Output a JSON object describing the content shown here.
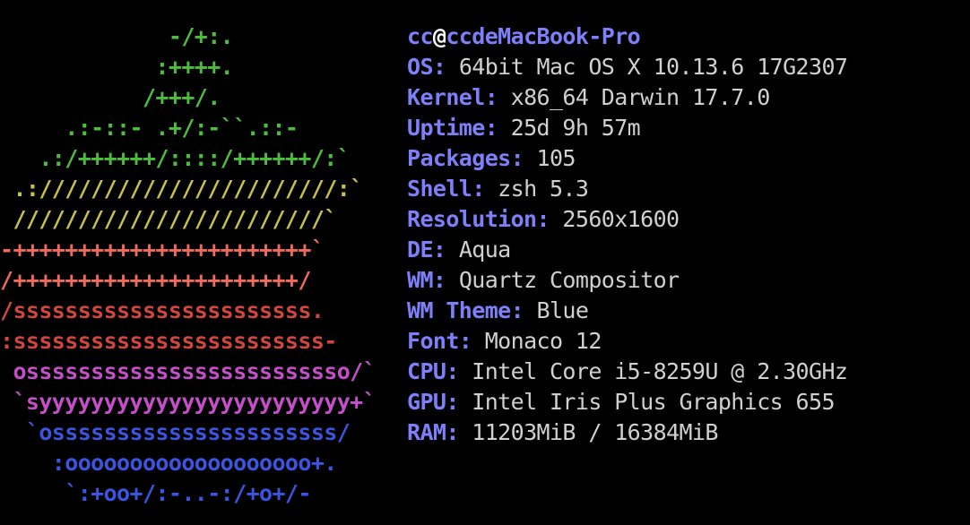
{
  "header": {
    "user": "cc",
    "at": "@",
    "host": "ccdeMacBook-Pro"
  },
  "logo": {
    "lines": [
      {
        "text": "             -/+:.",
        "color": "#4dbd3d"
      },
      {
        "text": "            :++++.",
        "color": "#4dbd3d"
      },
      {
        "text": "           /+++/.",
        "color": "#4dbd3d"
      },
      {
        "text": "     .:-::- .+/:-``.::-",
        "color": "#4dbd3d"
      },
      {
        "text": "   .:/++++++/::::/++++++/:`",
        "color": "#4dbd3d"
      },
      {
        "text": " .:///////////////////////:`",
        "color": "#c9c24a"
      },
      {
        "text": " ////////////////////////`",
        "color": "#c9c24a"
      },
      {
        "text": "-+++++++++++++++++++++++`",
        "color": "#ee6a5e"
      },
      {
        "text": "/++++++++++++++++++++++/",
        "color": "#ee6a5e"
      },
      {
        "text": "/sssssssssssssssssssssss.",
        "color": "#d1473d"
      },
      {
        "text": ":ssssssssssssssssssssssss-",
        "color": "#d1473d"
      },
      {
        "text": " osssssssssssssssssssssssso/`",
        "color": "#c44fc9"
      },
      {
        "text": " `syyyyyyyyyyyyyyyyyyyyyyyy+`",
        "color": "#c44fc9"
      },
      {
        "text": "  `ossssssssssssssssssssss/",
        "color": "#3b55e0"
      },
      {
        "text": "    :ooooooooooooooooooo+.",
        "color": "#3b55e0"
      },
      {
        "text": "     `:+oo+/:-..-:/+o+/-",
        "color": "#3b55e0"
      }
    ]
  },
  "info": [
    {
      "label": "OS:",
      "value": "64bit Mac OS X 10.13.6 17G2307"
    },
    {
      "label": "Kernel:",
      "value": "x86_64 Darwin 17.7.0"
    },
    {
      "label": "Uptime:",
      "value": "25d 9h 57m"
    },
    {
      "label": "Packages:",
      "value": "105"
    },
    {
      "label": "Shell:",
      "value": "zsh 5.3"
    },
    {
      "label": "Resolution:",
      "value": "2560x1600"
    },
    {
      "label": "DE:",
      "value": "Aqua"
    },
    {
      "label": "WM:",
      "value": "Quartz Compositor"
    },
    {
      "label": "WM Theme:",
      "value": "Blue"
    },
    {
      "label": "Font:",
      "value": "Monaco 12"
    },
    {
      "label": "CPU:",
      "value": "Intel Core i5-8259U @ 2.30GHz"
    },
    {
      "label": "GPU:",
      "value": "Intel Iris Plus Graphics 655"
    },
    {
      "label": "RAM:",
      "value": "11203MiB / 16384MiB"
    }
  ],
  "colors": {
    "background": "#000000",
    "label": "#7d80f8",
    "value": "#d0d0d0",
    "at": "#ffffff"
  }
}
